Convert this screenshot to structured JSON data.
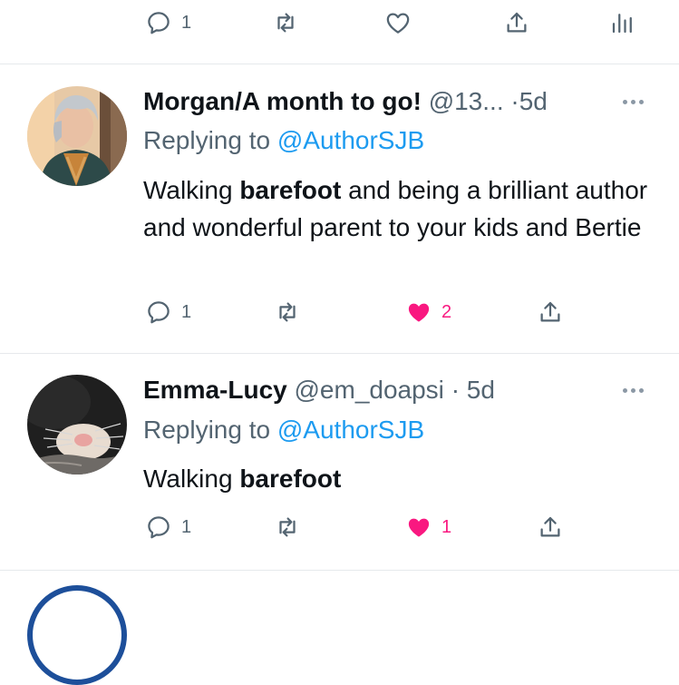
{
  "top_actions": {
    "reply_count": "1",
    "retweet_count": "",
    "like_count": ""
  },
  "tweets": [
    {
      "name": "Morgan/A month to go!",
      "handle": "@13...",
      "separator": "·",
      "time": "5d",
      "replying_prefix": "Replying to",
      "replying_to": "@AuthorSJB",
      "text_before": "Walking ",
      "text_bold": "barefoot",
      "text_after": " and being a brilliant author and wonderful parent to your kids and Bertie",
      "reply_count": "1",
      "retweet_count": "",
      "like_count": "2",
      "liked": true
    },
    {
      "name": "Emma-Lucy",
      "handle": "@em_doapsi",
      "separator": "·",
      "time": "5d",
      "replying_prefix": "Replying to",
      "replying_to": "@AuthorSJB",
      "text_before": "Walking ",
      "text_bold": "barefoot",
      "text_after": "",
      "reply_count": "1",
      "retweet_count": "",
      "like_count": "1",
      "liked": true
    }
  ],
  "colors": {
    "text": "#0f1419",
    "muted": "#536471",
    "link": "#1d9bf0",
    "like": "#f91880",
    "divider": "#e6e9ec"
  },
  "icons": [
    "reply-icon",
    "retweet-icon",
    "like-icon",
    "share-icon",
    "analytics-icon",
    "more-icon"
  ]
}
